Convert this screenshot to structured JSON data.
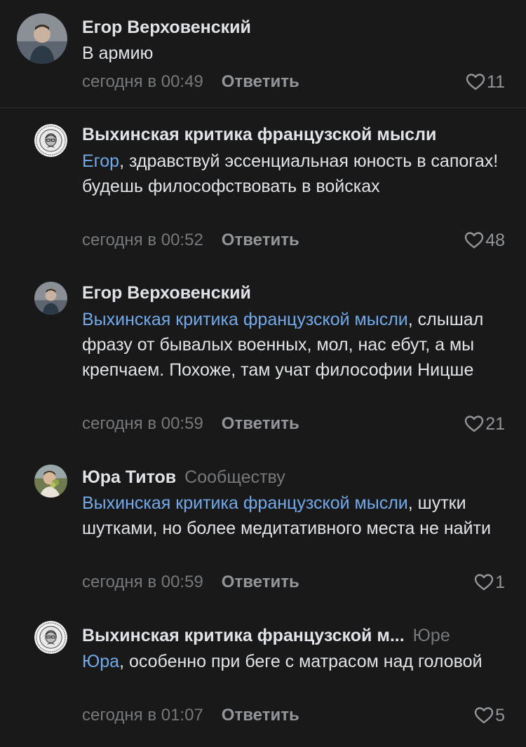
{
  "comments": [
    {
      "author": "Егор Верховенский",
      "reply_to": "",
      "mention": "",
      "text": "В армию",
      "time": "сегодня в 00:49",
      "reply_label": "Ответить",
      "likes": "11"
    },
    {
      "author": "Выхинская критика французской мысли",
      "reply_to": "",
      "mention": "Егор",
      "text": ", здравствуй эссенциальная юность в сапогах! будешь философствовать в войсках",
      "time": "сегодня в 00:52",
      "reply_label": "Ответить",
      "likes": "48"
    },
    {
      "author": "Егор Верховенский",
      "reply_to": "",
      "mention": "Выхинская критика французской мысли",
      "text": ", слышал фразу от бывалых военных, мол, нас ебут, а мы крепчаем. Похоже, там учат философии Ницше",
      "time": "сегодня в 00:59",
      "reply_label": "Ответить",
      "likes": "21"
    },
    {
      "author": "Юра Титов",
      "reply_to": "Сообществу",
      "mention": "Выхинская критика французской мысли",
      "text": ", шутки шутками, но более медитативного места не найти",
      "time": "сегодня в 00:59",
      "reply_label": "Ответить",
      "likes": "1"
    },
    {
      "author": "Выхинская критика французской м...",
      "reply_to": "Юре",
      "mention": "Юра",
      "text": ", особенно при беге с матрасом над головой",
      "time": "сегодня в 01:07",
      "reply_label": "Ответить",
      "likes": "5"
    }
  ]
}
